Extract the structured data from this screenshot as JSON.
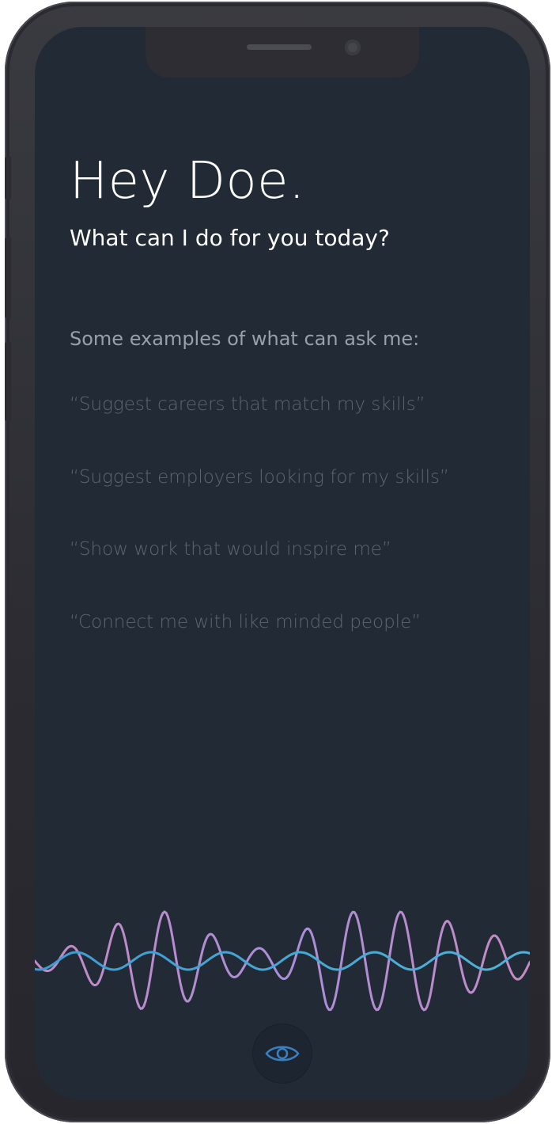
{
  "greeting": "Hey Doe.",
  "subtitle": "What can I do for you today?",
  "examples_heading": "Some examples of what can ask me:",
  "examples": [
    "“Suggest careers that match my skills”",
    "“Suggest employers looking for my skills”",
    "“Show work that would inspire me”",
    "“Connect me with like minded people”"
  ],
  "colors": {
    "screen_background": "#222b35",
    "wave_purple": "#b47fc9",
    "wave_blue": "#3e9bd4",
    "eye_icon": "#3a7fc0"
  },
  "icons": {
    "voice_button": "eye-icon"
  }
}
